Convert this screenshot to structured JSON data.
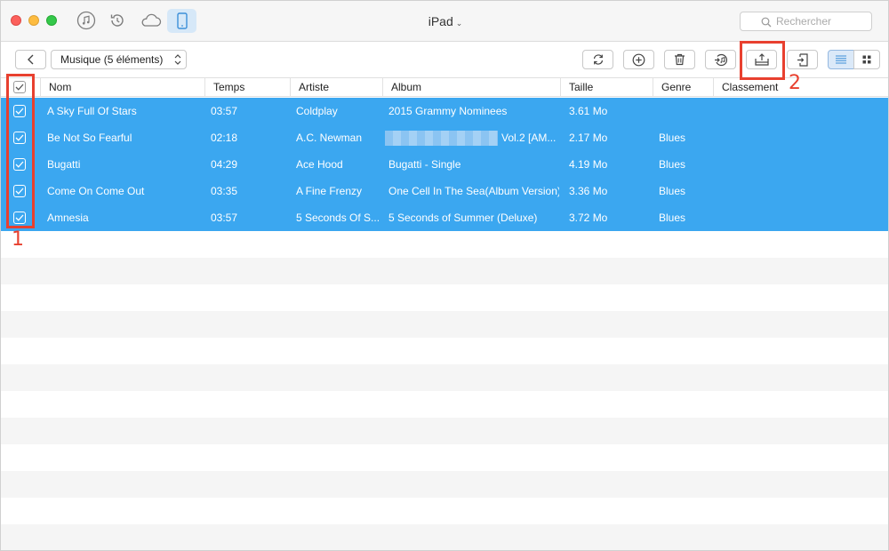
{
  "window": {
    "title": "iPad"
  },
  "search": {
    "placeholder": "Rechercher"
  },
  "toolbar": {
    "category_label": "Musique (5 éléments)"
  },
  "table": {
    "columns": [
      "Nom",
      "Temps",
      "Artiste",
      "Album",
      "Taille",
      "Genre",
      "Classement"
    ],
    "rows": [
      {
        "nom": "A Sky Full Of Stars",
        "temps": "03:57",
        "artiste": "Coldplay",
        "album": "2015 Grammy Nominees",
        "taille": "3.61 Mo",
        "genre": ""
      },
      {
        "nom": "Be Not So Fearful",
        "temps": "02:18",
        "artiste": "A.C. Newman",
        "album": "Vol.2 [AM...",
        "taille": "2.17 Mo",
        "genre": "Blues"
      },
      {
        "nom": "Bugatti",
        "temps": "04:29",
        "artiste": "Ace Hood",
        "album": "Bugatti - Single",
        "taille": "4.19 Mo",
        "genre": "Blues"
      },
      {
        "nom": "Come On Come Out",
        "temps": "03:35",
        "artiste": "A Fine Frenzy",
        "album": "One Cell In The Sea(Album Version)",
        "taille": "3.36 Mo",
        "genre": "Blues"
      },
      {
        "nom": "Amnesia",
        "temps": "03:57",
        "artiste": "5 Seconds Of S...",
        "album": "5 Seconds of Summer (Deluxe)",
        "taille": "3.72 Mo",
        "genre": "Blues"
      }
    ]
  },
  "annotations": {
    "marker_1": "1",
    "marker_2": "2"
  },
  "colors": {
    "selection": "#3ba7f0",
    "annotation": "#e8402f",
    "device_tab": "#d6e8f8"
  },
  "icons": [
    "close-window",
    "minimize-window",
    "zoom-window",
    "music-note-icon",
    "history-icon",
    "cloud-icon",
    "ipad-icon",
    "search-icon",
    "back-chevron-icon",
    "refresh-icon",
    "add-icon",
    "trash-icon",
    "music-to-itunes-icon",
    "export-to-computer-icon",
    "import-to-device-icon",
    "list-view-icon",
    "grid-view-icon"
  ]
}
